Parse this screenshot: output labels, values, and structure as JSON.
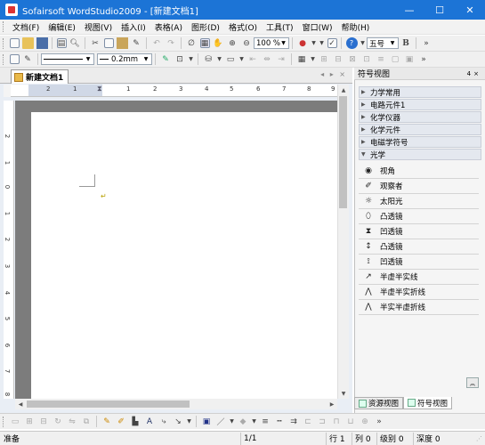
{
  "window": {
    "title": "Sofairsoft WordStudio2009 - [新建文档1]",
    "min_icon": "minimize-icon",
    "max_icon": "maximize-icon",
    "close_icon": "close-icon"
  },
  "menu": {
    "items": [
      "文档(F)",
      "编辑(E)",
      "视图(V)",
      "插入(I)",
      "表格(A)",
      "图形(D)",
      "格式(O)",
      "工具(T)",
      "窗口(W)",
      "帮助(H)"
    ]
  },
  "toolbar1": {
    "zoom": "100 %",
    "font_size": "五号",
    "bold": "B"
  },
  "toolbar2": {
    "line_width": "0.2mm"
  },
  "document": {
    "tab_label": "新建文档1",
    "hruler_labels": [
      "2",
      "1",
      "1",
      "2",
      "3",
      "4",
      "5",
      "6",
      "7",
      "8",
      "9"
    ],
    "vruler_labels": [
      "2",
      "1",
      "0",
      "1",
      "2",
      "3",
      "4",
      "5",
      "6",
      "7",
      "8"
    ],
    "para_mark": "↵"
  },
  "right_panel": {
    "title": "符号视图",
    "pin": "4",
    "close": "×",
    "categories": [
      "力学常用",
      "电路元件1",
      "化学仪器",
      "化学元件",
      "电磁学符号",
      "光学"
    ],
    "symbols": [
      {
        "icon": "eye-icon",
        "label": "视角"
      },
      {
        "icon": "observer-icon",
        "label": "观察者"
      },
      {
        "icon": "sun-icon",
        "label": "太阳光"
      },
      {
        "icon": "convex-lens-icon",
        "label": "凸透镜"
      },
      {
        "icon": "concave-lens-icon",
        "label": "凹透镜"
      },
      {
        "icon": "convex-lens-symbol-icon",
        "label": "凸透镜"
      },
      {
        "icon": "concave-lens-symbol-icon",
        "label": "凹透镜"
      },
      {
        "icon": "half-ray-icon",
        "label": "半虚半实线"
      },
      {
        "icon": "half-fold-icon",
        "label": "半虚半实折线"
      },
      {
        "icon": "solid-dashed-fold-icon",
        "label": "半实半虚折线"
      }
    ],
    "tabs": [
      "资源视图",
      "符号视图"
    ]
  },
  "status": {
    "ready": "准备",
    "page": "1/1",
    "row": "行 1",
    "col": "列 0",
    "level": "级别 0",
    "depth": "深度 0"
  }
}
